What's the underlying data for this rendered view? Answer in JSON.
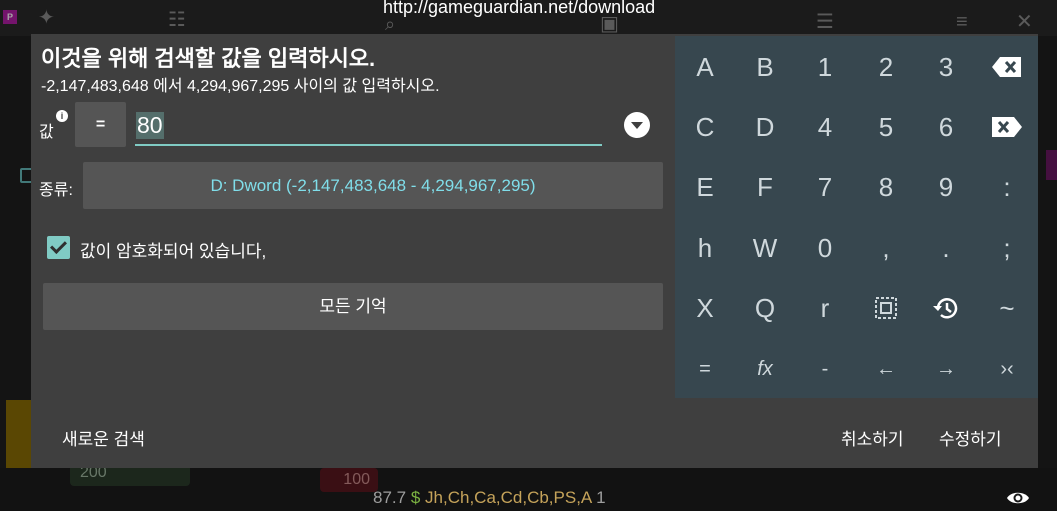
{
  "background": {
    "url": "http://gameguardian.net/download",
    "card_value": "200",
    "card_value_2": "100",
    "status_prefix": "87.7",
    "status_dollar": "$",
    "status_regs": "Jh,Ch,Ca,Cd,Cb,PS,A",
    "status_count": "1"
  },
  "dialog": {
    "title": "이것을 위해 검색할 값을 입력하시오.",
    "subtitle": "-2,147,483,648 에서 4,294,967,295 사이의 값 입력하시오.",
    "value_label": "값",
    "operator": "=",
    "value": "80",
    "type_label": "종류:",
    "type_value": "D: Dword (-2,147,483,648 - 4,294,967,295)",
    "encrypted_label": "값이 암호화되어 있습니다,",
    "encrypted_checked": true,
    "memory_button": "모든 기억",
    "new_search": "새로운 검색",
    "cancel": "취소하기",
    "ok": "수정하기"
  },
  "keypad": {
    "rows": [
      [
        "A",
        "B",
        "1",
        "2",
        "3",
        "backspace-icon"
      ],
      [
        "C",
        "D",
        "4",
        "5",
        "6",
        "delete-icon"
      ],
      [
        "E",
        "F",
        "7",
        "8",
        "9",
        ":"
      ],
      [
        "h",
        "W",
        "0",
        ",",
        ".",
        ";"
      ],
      [
        "X",
        "Q",
        "r",
        "select-all-icon",
        "history-icon",
        "~"
      ],
      [
        "=",
        "fx",
        "-",
        "←",
        "→",
        "›‹"
      ]
    ]
  },
  "colors": {
    "dialog_bg": "#3f3f3f",
    "keypad_bg": "#37474f",
    "accent": "#80cbc4",
    "type_text": "#80deea",
    "button_bg": "#555555"
  }
}
